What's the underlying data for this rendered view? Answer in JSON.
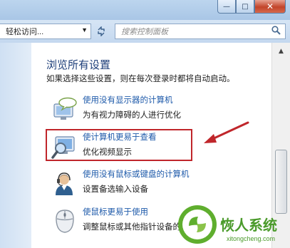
{
  "window": {
    "minimize": "—",
    "maximize": "□",
    "close": "✕"
  },
  "address": {
    "breadcrumb": "轻松访问...",
    "search_placeholder": "搜索控制面板"
  },
  "content": {
    "heading": "浏览所有设置",
    "description": "如果选择这些设置，则在每次登录时都将自动启动。",
    "items": [
      {
        "link": "使用没有显示器的计算机",
        "sub": "为有视力障碍的人进行优化",
        "icon": "monitor-speech-icon"
      },
      {
        "link": "使计算机更易于查看",
        "sub": "优化视频显示",
        "icon": "magnifier-monitor-icon"
      },
      {
        "link": "使用没有鼠标或键盘的计算机",
        "sub": "设置备选输入设备",
        "icon": "user-headset-icon"
      },
      {
        "link": "使鼠标更易于使用",
        "sub": "调整鼠标或其他指针设备的设置",
        "icon": "mouse-icon"
      }
    ]
  },
  "watermark": {
    "brand": "恢人系统",
    "url": "xitongcheng.com"
  },
  "colors": {
    "link": "#1e5aaa",
    "heading": "#1e3f7a",
    "highlight": "#c0262b"
  }
}
